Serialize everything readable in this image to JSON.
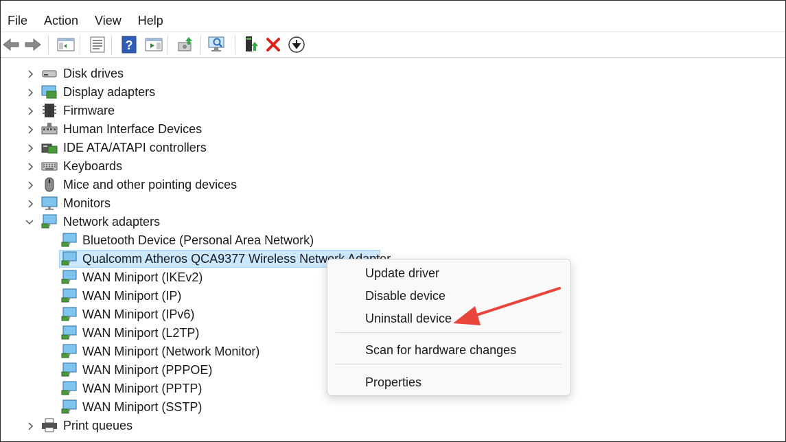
{
  "menubar": {
    "file": "File",
    "action": "Action",
    "view": "View",
    "help": "Help"
  },
  "toolbar": {
    "icons": [
      "back-arrow-icon",
      "forward-arrow-icon",
      "show-hide-console-tree-icon",
      "properties-icon",
      "help-icon",
      "action-pane-icon",
      "update-driver-icon",
      "scan-hardware-icon",
      "enable-device-icon",
      "uninstall-device-icon",
      "disable-device-icon"
    ]
  },
  "tree": {
    "categories": [
      {
        "label": "Disk drives",
        "icon": "disk-drive-icon",
        "expanded": false
      },
      {
        "label": "Display adapters",
        "icon": "display-adapter-icon",
        "expanded": false
      },
      {
        "label": "Firmware",
        "icon": "firmware-icon",
        "expanded": false
      },
      {
        "label": "Human Interface Devices",
        "icon": "hid-icon",
        "expanded": false
      },
      {
        "label": "IDE ATA/ATAPI controllers",
        "icon": "ide-controller-icon",
        "expanded": false
      },
      {
        "label": "Keyboards",
        "icon": "keyboard-icon",
        "expanded": false
      },
      {
        "label": "Mice and other pointing devices",
        "icon": "mouse-icon",
        "expanded": false
      },
      {
        "label": "Monitors",
        "icon": "monitor-icon",
        "expanded": false
      },
      {
        "label": "Network adapters",
        "icon": "network-adapter-icon",
        "expanded": true
      }
    ],
    "network_children": [
      "Bluetooth Device (Personal Area Network)",
      "Qualcomm Atheros QCA9377 Wireless Network Adapter",
      "WAN Miniport (IKEv2)",
      "WAN Miniport (IP)",
      "WAN Miniport (IPv6)",
      "WAN Miniport (L2TP)",
      "WAN Miniport (Network Monitor)",
      "WAN Miniport (PPPOE)",
      "WAN Miniport (PPTP)",
      "WAN Miniport (SSTP)"
    ],
    "selected_child": "Qualcomm Atheros QCA9377 Wireless Network Adapter",
    "after": [
      {
        "label": "Print queues",
        "icon": "printer-icon",
        "expanded": false
      }
    ]
  },
  "context_menu": {
    "update_driver": "Update driver",
    "disable_device": "Disable device",
    "uninstall_device": "Uninstall device",
    "scan_hardware": "Scan for hardware changes",
    "properties": "Properties"
  },
  "colors": {
    "selection_bg": "#cce8ff",
    "selection_border": "#99d1ff",
    "annotation_arrow": "#e8453c",
    "delete_x": "#e0201b"
  }
}
